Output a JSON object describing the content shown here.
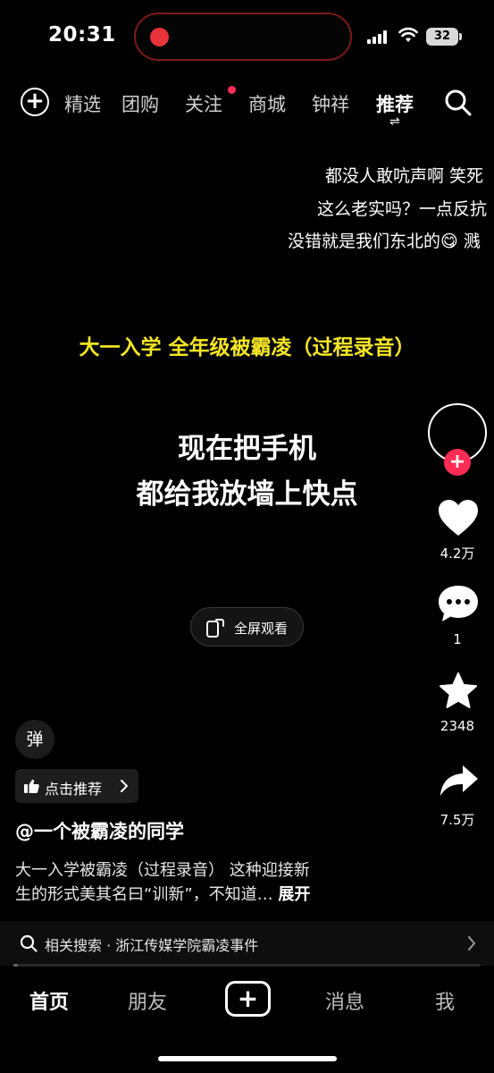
{
  "status_bar": {
    "time": "20:31",
    "battery": "32"
  },
  "top_nav": {
    "tabs": [
      "精选",
      "团购",
      "关注",
      "商城",
      "钟祥",
      "推荐"
    ],
    "active_tab": "推荐",
    "notification_tab": "关注"
  },
  "danmaku": [
    "都没人敢吭声啊 笑死",
    "这么老实吗？一点反抗",
    "没错就是我们东北的😋 溅"
  ],
  "video": {
    "title_overlay": "大一入学 全年级被霸凌（过程录音）",
    "subtitle_line1": "现在把手机",
    "subtitle_line2": "都给我放墙上快点",
    "fullscreen_label": "全屏观看"
  },
  "actions": {
    "likes": "4.2万",
    "comments": "1",
    "favorites": "2348",
    "shares": "7.5万"
  },
  "danmaku_toggle": "弹",
  "recommend_label": "点击推荐",
  "author": "@一个被霸凌的同学",
  "description_line1": "大一入学被霸凌（过程录音） 这种迎接新",
  "description_line2": "生的形式美其名曰“训新”，不知道…",
  "expand_label": "展开",
  "related_search": "相关搜索 · 浙江传媒学院霸凌事件",
  "progress_fraction": 0.01,
  "bottom_nav": {
    "home": "首页",
    "friends": "朋友",
    "messages": "消息",
    "me": "我"
  },
  "colors": {
    "accent": "#ff2c55",
    "title_yellow": "#f5e626",
    "record": "#e8333a"
  }
}
